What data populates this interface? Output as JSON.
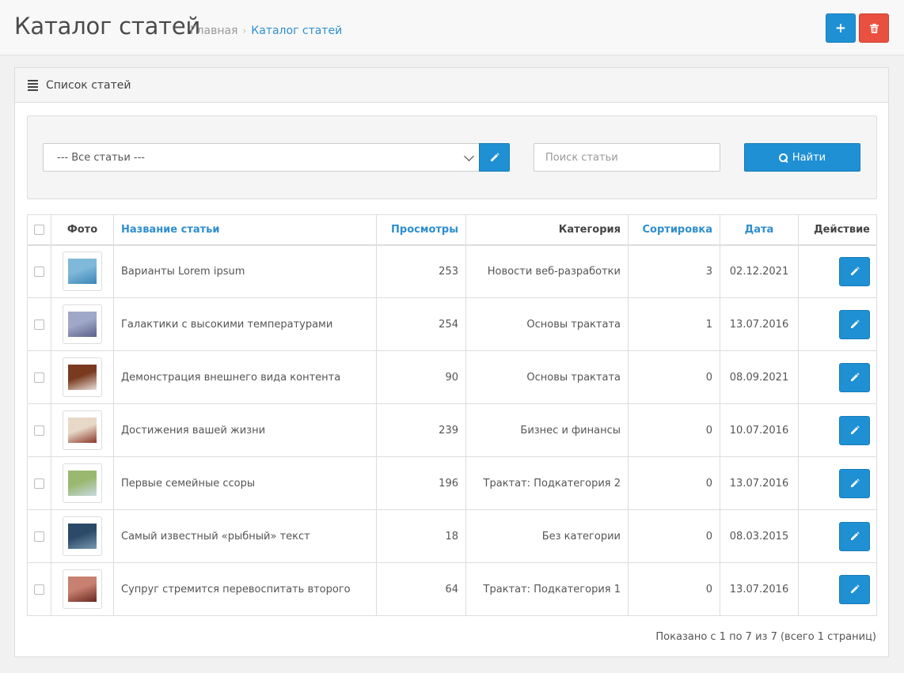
{
  "header": {
    "title": "Каталог статей",
    "breadcrumb": {
      "home": "Главная",
      "separator": "›",
      "current": "Каталог статей"
    },
    "add_label": "+"
  },
  "panel": {
    "title": "Список статей"
  },
  "filter": {
    "select_value": "--- Все статьи ---",
    "search_placeholder": "Поиск статьи",
    "find_label": "Найти"
  },
  "table": {
    "columns": {
      "photo": "Фото",
      "name": "Название статьи",
      "views": "Просмотры",
      "category": "Категория",
      "sort": "Сортировка",
      "date": "Дата",
      "action": "Действие"
    },
    "rows": [
      {
        "name": "Варианты Lorem ipsum",
        "views": "253",
        "category": "Новости веб-разработки",
        "sort": "3",
        "date": "02.12.2021",
        "thumb_colors": [
          "#7fb8d8",
          "#3a86b8"
        ]
      },
      {
        "name": "Галактики с высокими температурами",
        "views": "254",
        "category": "Основы трактата",
        "sort": "1",
        "date": "13.07.2016",
        "thumb_colors": [
          "#a0a8c8",
          "#5a6088"
        ]
      },
      {
        "name": "Демонстрация внешнего вида контента",
        "views": "90",
        "category": "Основы трактата",
        "sort": "0",
        "date": "08.09.2021",
        "thumb_colors": [
          "#7a3a20",
          "#e8e0d8"
        ]
      },
      {
        "name": "Достижения вашей жизни",
        "views": "239",
        "category": "Бизнес и финансы",
        "sort": "0",
        "date": "10.07.2016",
        "thumb_colors": [
          "#e8d8c8",
          "#8a3828"
        ]
      },
      {
        "name": "Первые семейные ссоры",
        "views": "196",
        "category": "Трактат: Подкатегория 2",
        "sort": "0",
        "date": "13.07.2016",
        "thumb_colors": [
          "#9ab870",
          "#c8d8e0"
        ]
      },
      {
        "name": "Самый известный «рыбный» текст",
        "views": "18",
        "category": "Без категории",
        "sort": "0",
        "date": "08.03.2015",
        "thumb_colors": [
          "#2a4a68",
          "#7898b0"
        ]
      },
      {
        "name": "Супруг стремится перевоспитать второго",
        "views": "64",
        "category": "Трактат: Подкатегория 1",
        "sort": "0",
        "date": "13.07.2016",
        "thumb_colors": [
          "#c88070",
          "#6a2820"
        ]
      }
    ]
  },
  "pagination": {
    "info": "Показано с 1 по 7 из 7 (всего 1 страниц)"
  },
  "colors": {
    "primary": "#1f90d4",
    "danger": "#e9503f",
    "link": "#2e8ecf"
  }
}
